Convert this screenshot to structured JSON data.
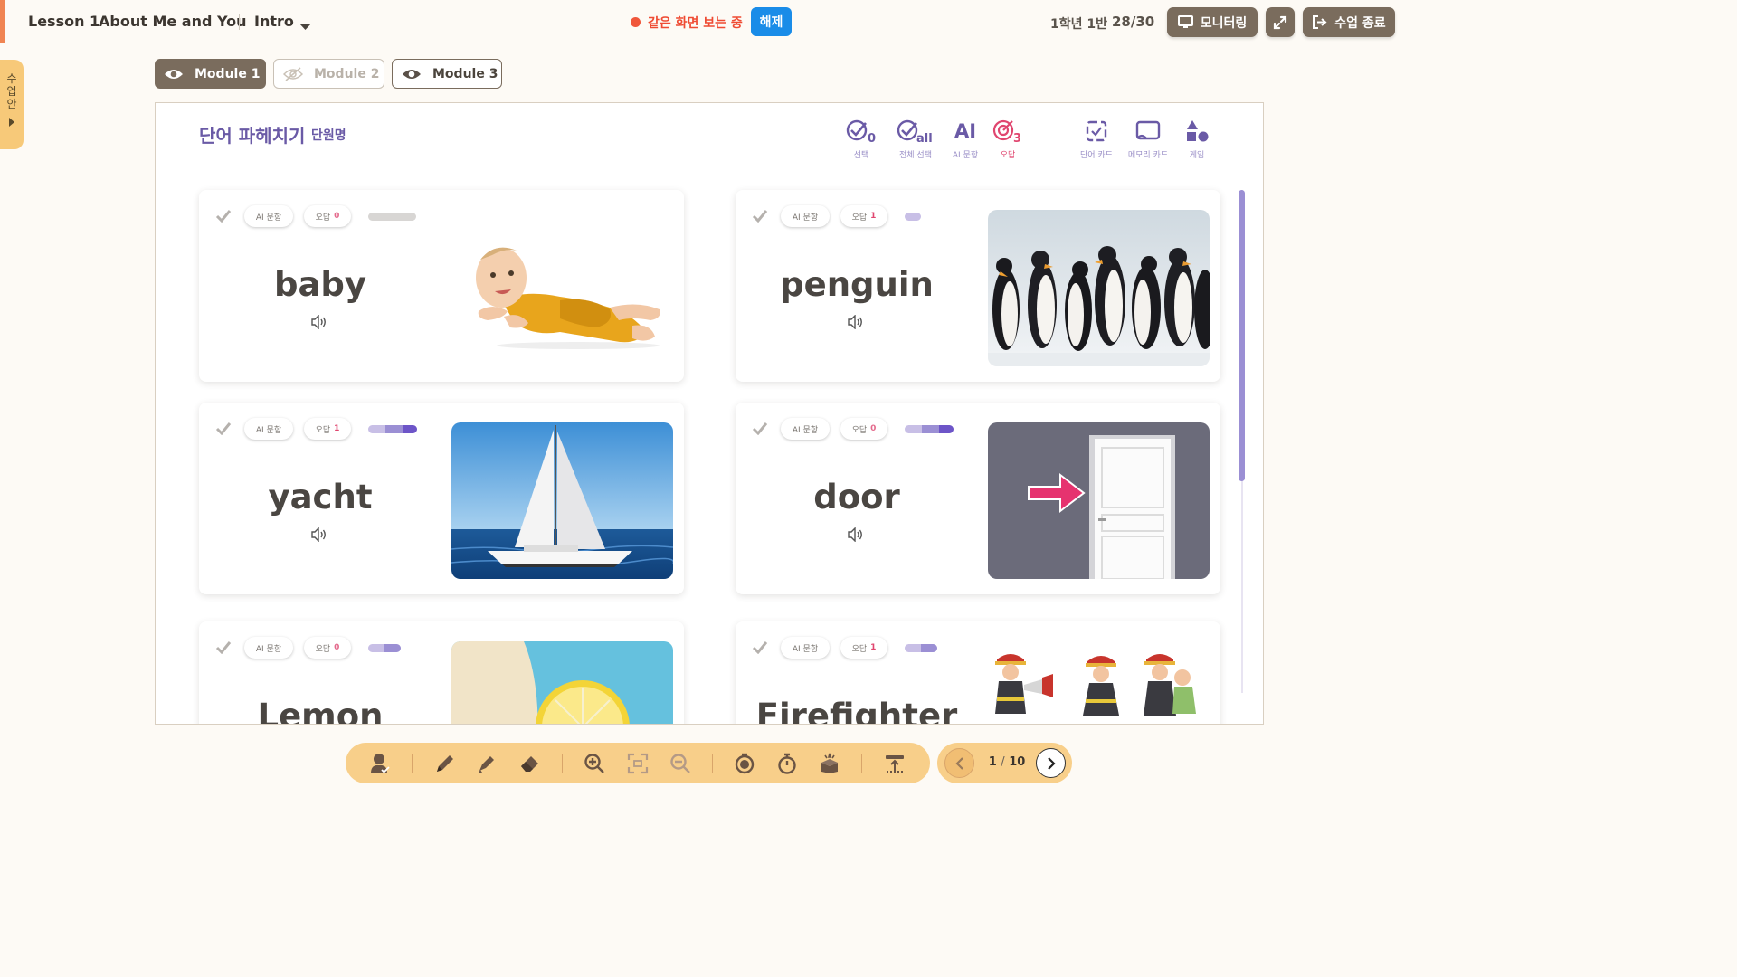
{
  "header": {
    "lesson": "Lesson 1",
    "title": "About Me and You",
    "subpage": "Intro",
    "live_status": "같은 화면 보는 중",
    "release_label": "해제",
    "class_info": "1학년 1반",
    "student_count": "28/30",
    "monitor_label": "모니터링",
    "end_class_label": "수업 종료"
  },
  "side_tab": {
    "label": "수업안"
  },
  "modules": [
    {
      "label": "Module 1",
      "state": "active"
    },
    {
      "label": "Module 2",
      "state": "hidden"
    },
    {
      "label": "Module 3",
      "state": "visible"
    }
  ],
  "panel": {
    "title": "단어 파헤치기",
    "subtitle": "단원명",
    "tools": [
      {
        "name": "select",
        "label": "선택",
        "badge": "0"
      },
      {
        "name": "select-all",
        "label": "전체 선택",
        "badge": "all"
      },
      {
        "name": "ai-sentence",
        "label": "AI 문항",
        "text": "AI"
      },
      {
        "name": "wrong-answers",
        "label": "오답",
        "badge": "3"
      },
      {
        "name": "word-card",
        "label": "단어 카드"
      },
      {
        "name": "memory-card",
        "label": "메모리 카드"
      },
      {
        "name": "game",
        "label": "게임"
      }
    ]
  },
  "card_labels": {
    "ai": "AI 문항",
    "wrong": "오답"
  },
  "cards": [
    {
      "word": "baby",
      "wrong_count": "0",
      "progress": [
        0.3,
        0.3,
        0.4
      ],
      "image": "baby"
    },
    {
      "word": "penguin",
      "wrong_count": "1",
      "progress": [
        1.0
      ],
      "image": "penguin"
    },
    {
      "word": "yacht",
      "wrong_count": "1",
      "progress": [
        0.35,
        0.35,
        0.3
      ],
      "image": "yacht"
    },
    {
      "word": "door",
      "wrong_count": "0",
      "progress": [
        0.35,
        0.35,
        0.3
      ],
      "image": "door"
    },
    {
      "word": "Lemon",
      "wrong_count": "0",
      "progress": [
        0.5,
        0.5
      ],
      "image": "lemon"
    },
    {
      "word": "Firefighter",
      "wrong_count": "1",
      "progress": [
        0.5,
        0.5
      ],
      "image": "firefighter"
    }
  ],
  "colors": {
    "accent_brown": "#7a6c5d",
    "purple": "#6a5aa6",
    "bar_light": "#c8bfe6",
    "bar_mid": "#9b8fd4",
    "bar_dark": "#6d55c8",
    "bar_grey": "#d8d6d4",
    "dock": "#f8cf8a",
    "live_red": "#ef4b33",
    "release_blue": "#1a8ce8"
  },
  "bottom_toolbar": {
    "tools": [
      "student-icon",
      "pen-icon",
      "highlighter-icon",
      "eraser-icon",
      "zoom-in-icon",
      "fit-screen-icon",
      "zoom-out-icon",
      "timer-icon",
      "stopwatch-icon",
      "random-box-icon",
      "screen-cover-icon"
    ]
  },
  "pager": {
    "current": "1",
    "total": "10"
  }
}
